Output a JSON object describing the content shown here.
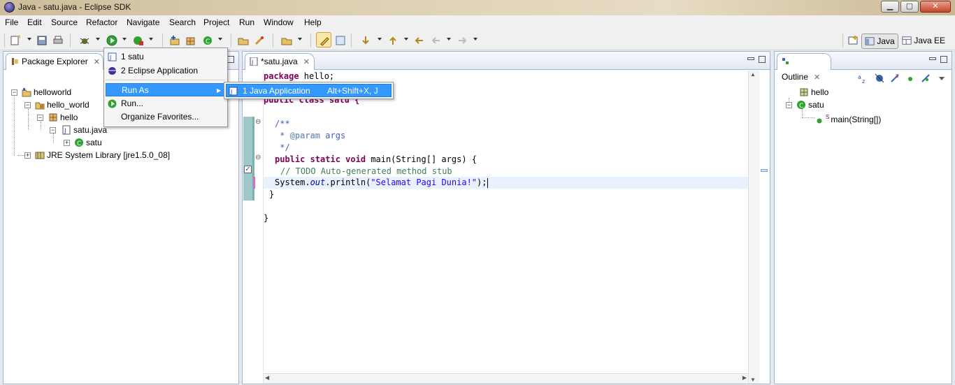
{
  "window": {
    "title": "Java - satu.java - Eclipse SDK",
    "min": "▁",
    "max": "▢",
    "close": "✕"
  },
  "menubar": [
    "File",
    "Edit",
    "Source",
    "Refactor",
    "Navigate",
    "Search",
    "Project",
    "Run",
    "Window",
    "Help"
  ],
  "perspectives": {
    "java": "Java",
    "javaee": "Java EE"
  },
  "package_explorer": {
    "tab_label": "Package Explorer",
    "tree": {
      "project": "helloworld",
      "source_folder": "hello_world",
      "package": "hello",
      "file": "satu.java",
      "class": "satu",
      "library": "JRE System Library [jre1.5.0_08]"
    }
  },
  "editor": {
    "tab_label": "*satu.java",
    "lines": {
      "l1_kw": "package",
      "l1_rest": " hello;",
      "l3": "public class satu {",
      "l5": "/**",
      "l6_pre": " * ",
      "l6_tag": "@param",
      "l6_rest": " args",
      "l7": " */",
      "l8_kw": "public static void",
      "l8_rest": " main(String[] args) {",
      "l9": "// TODO Auto-generated method stub",
      "l10_a": "System.",
      "l10_out": "out",
      "l10_b": ".println(",
      "l10_str": "\"Selamat Pagi Dunia!\"",
      "l10_c": ");",
      "l11": "}",
      "l13": "}"
    }
  },
  "outline": {
    "tab_label": "Outline",
    "tree": {
      "package": "hello",
      "class": "satu",
      "method": "main(String[])",
      "static_mark": "S"
    }
  },
  "run_dropdown": {
    "items": [
      "1 satu",
      "2 Eclipse Application",
      "Run As",
      "Run...",
      "Organize Favorites..."
    ],
    "submenu_arrow": "▸"
  },
  "run_as_submenu": {
    "item": "1 Java Application",
    "shortcut": "Alt+Shift+X, J"
  },
  "colors": {
    "accent": "#3399ff",
    "keyword": "#7f0055",
    "comment": "#3f7f5f",
    "string": "#2a00ff",
    "javadoc": "#3f5fbf"
  }
}
